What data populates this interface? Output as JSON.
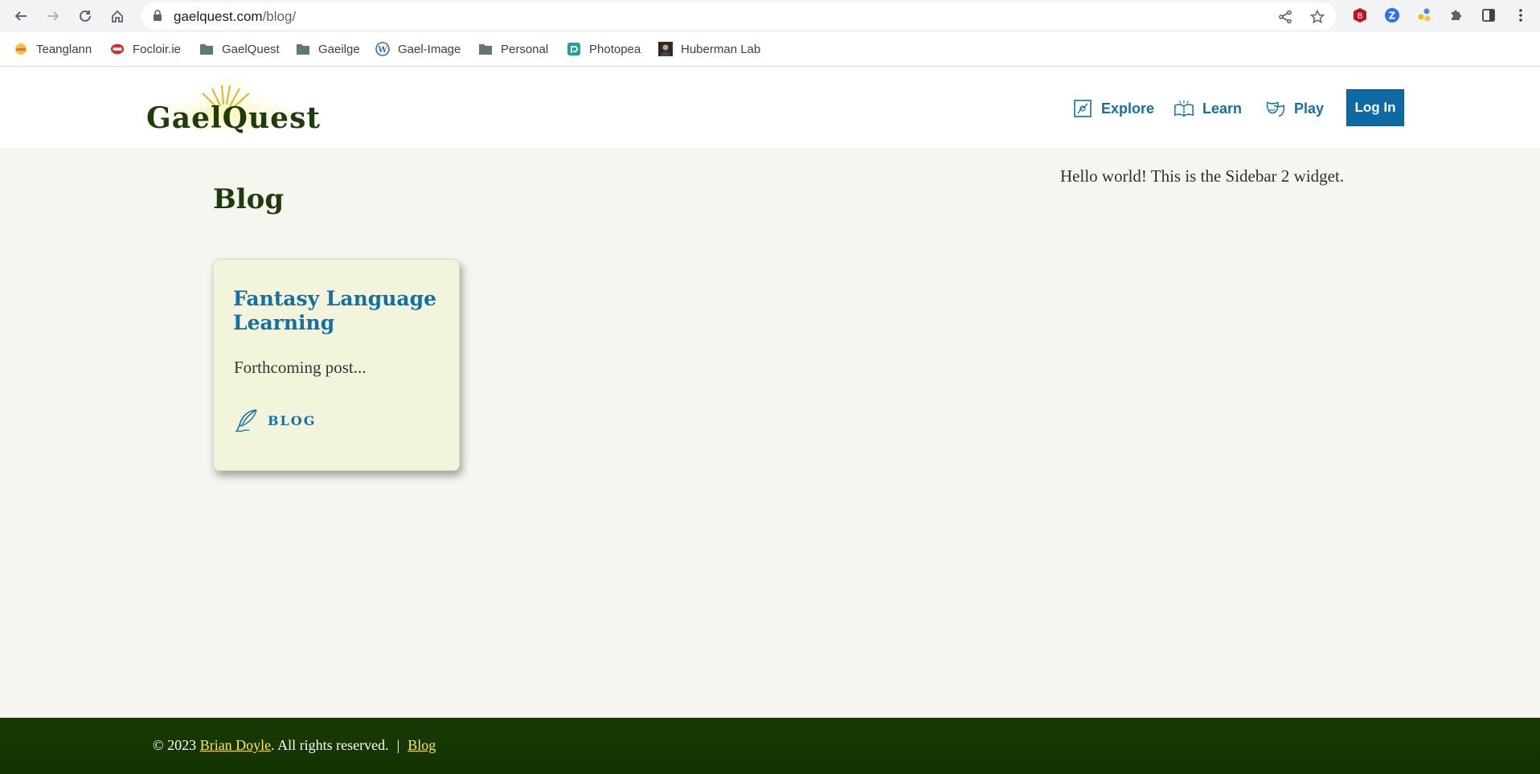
{
  "browser": {
    "url_host": "gaelquest.com",
    "url_path": "/blog/",
    "bookmarks": [
      {
        "label": "Teanglann",
        "icon": "teanglann-icon"
      },
      {
        "label": "Focloir.ie",
        "icon": "focloir-icon"
      },
      {
        "label": "GaelQuest",
        "icon": "folder-icon"
      },
      {
        "label": "Gaeilge",
        "icon": "folder-icon"
      },
      {
        "label": "Gael-Image",
        "icon": "wordpress-icon"
      },
      {
        "label": "Personal",
        "icon": "folder-icon"
      },
      {
        "label": "Photopea",
        "icon": "photopea-icon"
      },
      {
        "label": "Huberman Lab",
        "icon": "huberman-avatar-icon"
      }
    ]
  },
  "site": {
    "logo_text": "GaelQuest",
    "menu": [
      {
        "label": "Explore",
        "icon": "map-icon"
      },
      {
        "label": "Learn",
        "icon": "open-book-icon"
      },
      {
        "label": "Play",
        "icon": "theater-masks-icon"
      }
    ],
    "login_label": "Log In"
  },
  "page": {
    "title": "Blog",
    "sidebar_text": "Hello world! This is the Sidebar 2 widget."
  },
  "posts": [
    {
      "title": "Fantasy Language Learning",
      "excerpt": "Forthcoming post...",
      "category": "BLOG",
      "category_icon": "quill-feather-icon"
    }
  ],
  "footer": {
    "copyright_prefix": "© 2023",
    "author": "Brian Doyle",
    "rights": ". All rights reserved.",
    "separator": "|",
    "blog_link": "Blog"
  },
  "colors": {
    "accent": "#1370a5",
    "heading": "#1d3b0b",
    "footer_bg": "#163604",
    "footer_link": "#ffeb3b",
    "card_bg": "#f2f5dc",
    "page_bg": "#f6f6f0"
  }
}
